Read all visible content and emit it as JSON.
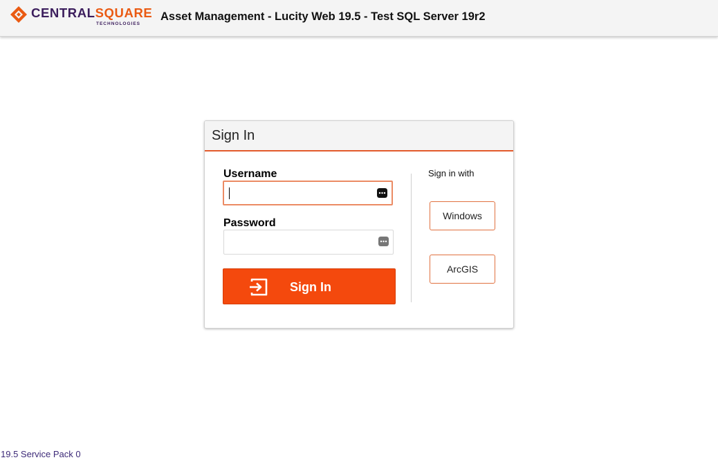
{
  "header": {
    "logo": {
      "brand_part1": "CENTRAL",
      "brand_part2": "SQUARE",
      "subtitle": "TECHNOLOGIES"
    },
    "app_title": "Asset Management - Lucity Web 19.5 - Test SQL Server 19r2"
  },
  "sign_in": {
    "title": "Sign In",
    "username": {
      "label": "Username",
      "value": "",
      "focused": true,
      "icon": "password-manager-icon"
    },
    "password": {
      "label": "Password",
      "value": "",
      "icon": "password-manager-icon"
    },
    "submit": {
      "label": "Sign In",
      "icon": "sign-in-icon"
    },
    "alternate": {
      "label": "Sign in with",
      "options": [
        "Windows",
        "ArcGIS"
      ]
    }
  },
  "footer": {
    "version": "19.5 Service Pack 0"
  },
  "colors": {
    "accent": "#f4490d",
    "brand_purple": "#3b1d5c",
    "brand_orange": "#ea5a12",
    "header_rule": "#e2592a"
  }
}
